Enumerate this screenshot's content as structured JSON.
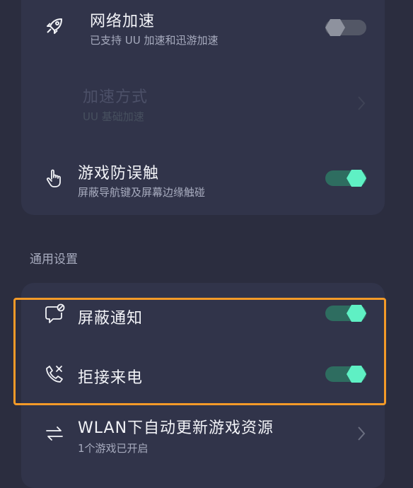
{
  "game_settings": {
    "network_boost": {
      "title": "网络加速",
      "subtitle": "已支持 UU 加速和迅游加速",
      "icon": "rocket-icon",
      "enabled": false
    },
    "boost_mode": {
      "title": "加速方式",
      "subtitle": "UU 基础加速",
      "disabled": true
    },
    "anti_mistouch": {
      "title": "游戏防误触",
      "subtitle": "屏蔽导航键及屏幕边缘触碰",
      "icon": "hand-pointer-icon",
      "enabled": true
    }
  },
  "general": {
    "header": "通用设置",
    "block_notifications": {
      "title": "屏蔽通知",
      "icon": "message-block-icon",
      "enabled": true
    },
    "reject_calls": {
      "title": "拒接来电",
      "icon": "phone-reject-icon",
      "enabled": true
    },
    "wlan_auto_update": {
      "title": "WLAN下自动更新游戏资源",
      "subtitle": "1个游戏已开启",
      "icon": "sync-arrows-icon"
    }
  },
  "colors": {
    "background": "#2b2d3f",
    "card": "#31344a",
    "toggle_on": "#5ff0c4",
    "highlight": "#f39a28"
  }
}
